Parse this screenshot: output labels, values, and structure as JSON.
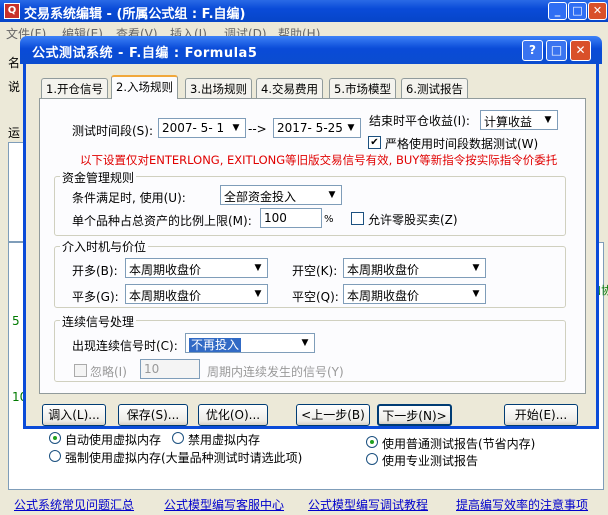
{
  "outer": {
    "app_icon": "Q",
    "title": "交易系统编辑 - (所属公式组 : F.自编)",
    "menu": [
      "文件(F)",
      "编辑(E)",
      "查看(V)",
      "插入(I)",
      "调试(D)",
      "帮助(H)"
    ],
    "side_labels": [
      "名",
      "说",
      "运"
    ],
    "side_numbers": [
      "5",
      "10"
    ],
    "right_edge_text": "加协"
  },
  "dialog": {
    "title": "公式测试系统 - F.自编 : Formula5",
    "buttons": {
      "help": "?",
      "close": "✕",
      "minimize": "_",
      "maximize": "□"
    }
  },
  "tabs": [
    "1.开仓信号",
    "2.入场规则",
    "3.出场规则",
    "4.交易费用",
    "5.市场模型",
    "6.测试报告"
  ],
  "active_tab": 1,
  "test_period": {
    "label": "测试时间段(S):",
    "start": "2007- 5- 1",
    "arrow": "-->",
    "end": "2017- 5-25",
    "close_label": "结束时平仓收益(I):",
    "close_value": "计算收益",
    "strict_label": "严格使用时间段数据测试(W)",
    "strict_checked": true
  },
  "notice": "以下设置仅对ENTERLONG, EXITLONG等旧版交易信号有效, BUY等新指令按实际指令价委托",
  "money_mgmt": {
    "title": "资金管理规则",
    "cond_label": "条件满足时, 使用(U):",
    "cond_value": "全部资金投入",
    "ratio_label": "单个品种占总资产的比例上限(M):",
    "ratio_value": "100",
    "ratio_unit": "%",
    "odd_label": "允许零股买卖(Z)",
    "odd_checked": false
  },
  "timing": {
    "title": "介入时机与价位",
    "open_long_label": "开多(B):",
    "open_long": "本周期收盘价",
    "open_short_label": "开空(K):",
    "open_short": "本周期收盘价",
    "close_long_label": "平多(G):",
    "close_long": "本周期收盘价",
    "close_short_label": "平空(Q):",
    "close_short": "本周期收盘价"
  },
  "consecutive": {
    "title": "连续信号处理",
    "label": "出现连续信号时(C):",
    "value": "不再投入",
    "ignore_label": "忽略(I)",
    "ignore_value": "10",
    "ignore_suffix": "周期内连续发生的信号(Y)"
  },
  "actions": {
    "load": "调入(L)...",
    "save": "保存(S)...",
    "optimize": "优化(O)...",
    "prev": "<上一步(B)",
    "next": "下一步(N)>",
    "start": "开始(E)..."
  },
  "options": {
    "auto_vm": "自动使用虚拟内存",
    "no_vm": "禁用虚拟内存",
    "force_vm": "强制使用虚拟内存(大量品种测试时请选此项)",
    "normal_report": "使用普通测试报告(节省内存)",
    "pro_report": "使用专业测试报告",
    "selected_vm": "auto_vm",
    "selected_report": "normal_report"
  },
  "bottom_links": [
    "公式系统常见问题汇总",
    "公式模型编写客服中心",
    "公式模型编写调试教程",
    "提高编写效率的注意事项"
  ]
}
